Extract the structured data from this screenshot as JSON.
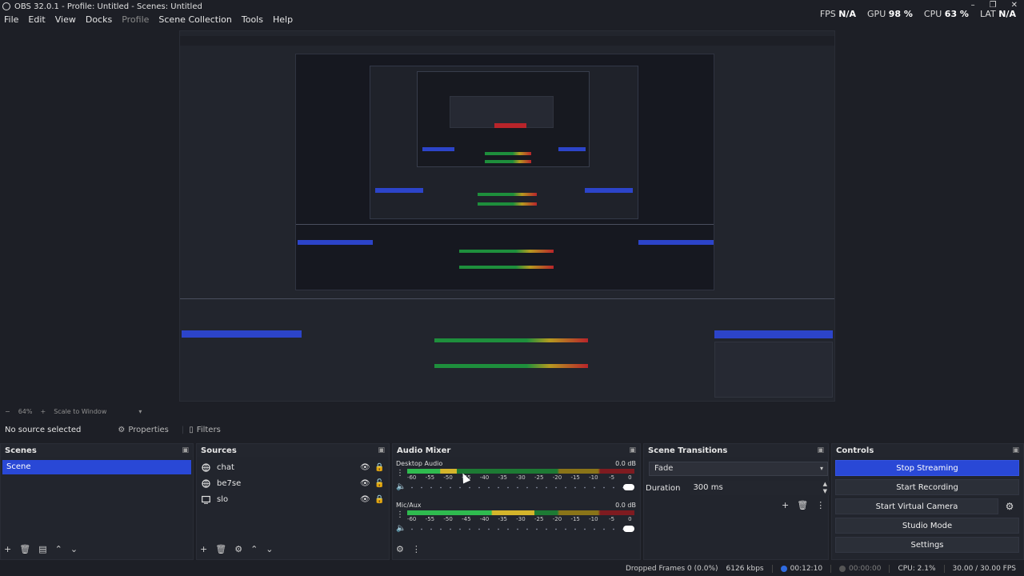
{
  "window": {
    "title": "OBS 32.0.1 - Profile: Untitled - Scenes: Untitled",
    "minimize": "–",
    "restore": "❐",
    "close": "✕"
  },
  "stats": {
    "fps_label": "FPS",
    "fps_value": "N/A",
    "gpu_label": "GPU",
    "gpu_value": "98 %",
    "cpu_label": "CPU",
    "cpu_value": "63 %",
    "lat_label": "LAT",
    "lat_value": "N/A"
  },
  "menu": [
    "File",
    "Edit",
    "View",
    "Docks",
    "Profile",
    "Scene Collection",
    "Tools",
    "Help"
  ],
  "zoom": {
    "value": "64%",
    "minus": "−",
    "plus": "+",
    "mode": "Scale to Window"
  },
  "sourcebar": {
    "status": "No source selected",
    "properties": "Properties",
    "filters": "Filters"
  },
  "scenes": {
    "title": "Scenes",
    "items": [
      "Scene"
    ]
  },
  "sources": {
    "title": "Sources",
    "items": [
      {
        "name": "chat",
        "icon": "browser-icon"
      },
      {
        "name": "be7se",
        "icon": "browser-icon"
      },
      {
        "name": "slo",
        "icon": "display-capture-icon"
      }
    ]
  },
  "mixer": {
    "title": "Audio Mixer",
    "ticks": [
      "-60",
      "-55",
      "-50",
      "-45",
      "-40",
      "-35",
      "-30",
      "-25",
      "-20",
      "-15",
      "-10",
      "-5",
      "0"
    ],
    "channels": [
      {
        "name": "Desktop Audio",
        "db": "0.0 dB",
        "level": 0.22,
        "volume": 1.0
      },
      {
        "name": "Mic/Aux",
        "db": "0.0 dB",
        "level": 0.56,
        "volume": 1.0
      }
    ]
  },
  "transitions": {
    "title": "Scene Transitions",
    "selected": "Fade",
    "duration_label": "Duration",
    "duration_value": "300 ms"
  },
  "controls": {
    "title": "Controls",
    "stop_streaming": "Stop Streaming",
    "start_recording": "Start Recording",
    "start_virtual_camera": "Start Virtual Camera",
    "studio_mode": "Studio Mode",
    "settings": "Settings"
  },
  "status": {
    "dropped": "Dropped Frames 0 (0.0%)",
    "bitrate": "6126 kbps",
    "stream_time": "00:12:10",
    "record_time": "00:00:00",
    "cpu": "CPU: 2.1%",
    "fps": "30.00 / 30.00 FPS"
  },
  "colors": {
    "accent": "#2948d6",
    "background": "#1d1f26",
    "panel": "#22252d",
    "meter_green": "#2fbb4f",
    "meter_yellow": "#d4b52b",
    "meter_red": "#b8242a"
  }
}
